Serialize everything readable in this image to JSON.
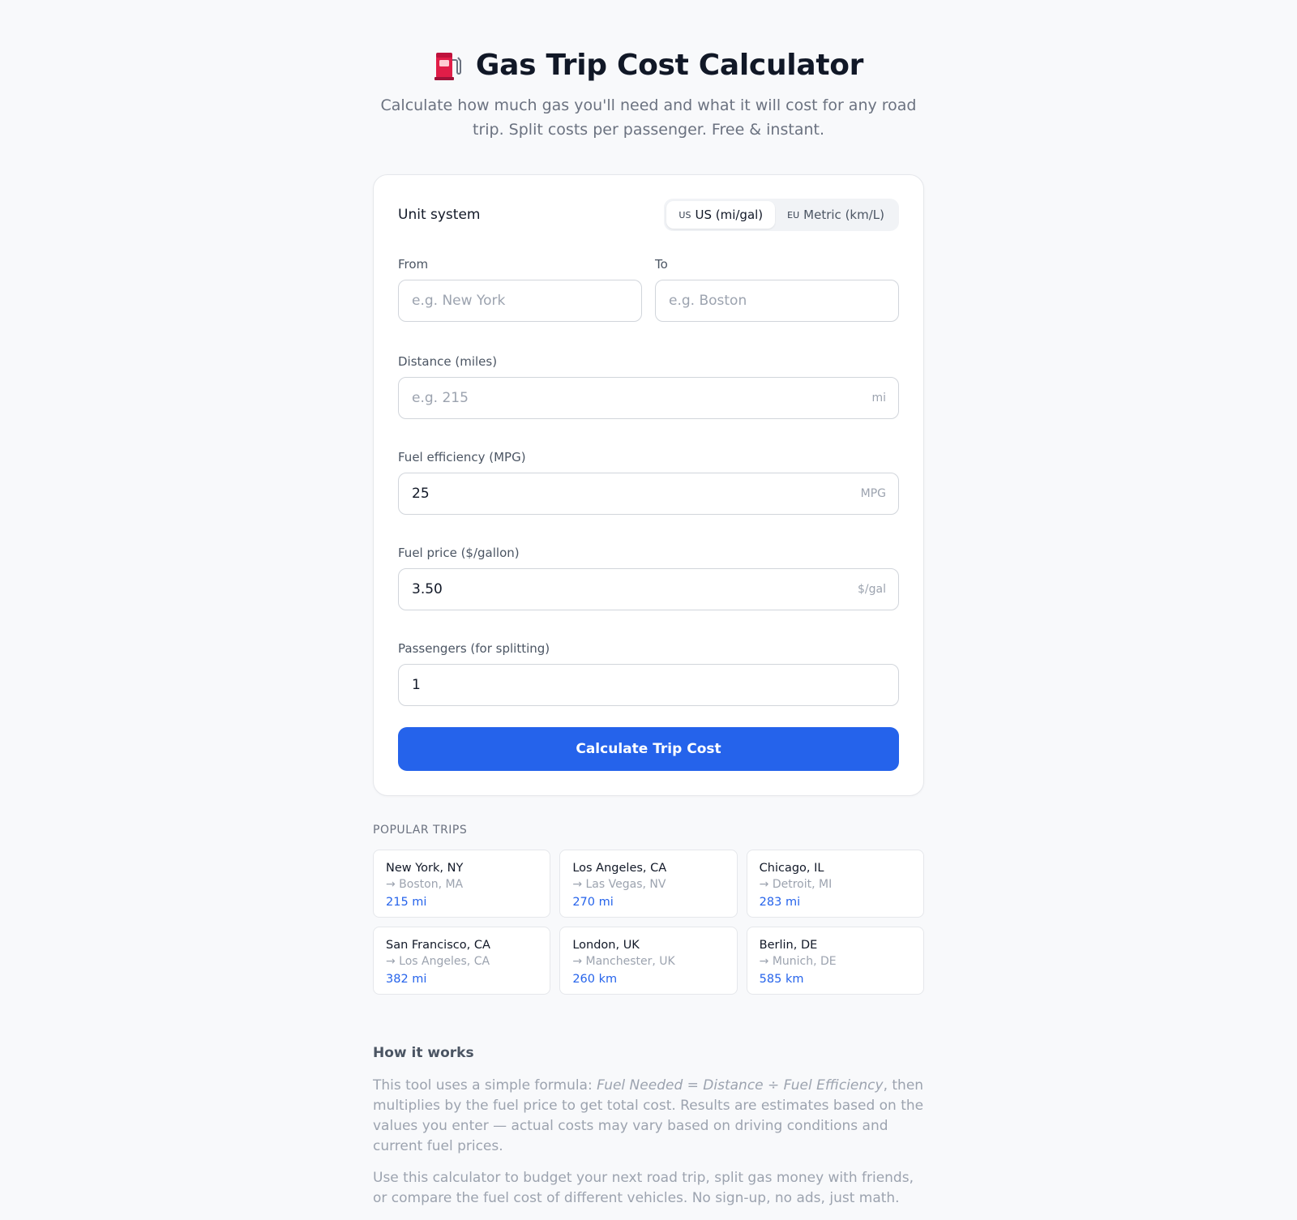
{
  "hero": {
    "icon": "fuel-pump-icon",
    "title": "Gas Trip Cost Calculator",
    "subtitle": "Calculate how much gas you'll need and what it will cost for any road trip. Split costs per passenger. Free & instant."
  },
  "form": {
    "unit_system_label": "Unit system",
    "units": [
      {
        "flag": "US",
        "label": "US (mi/gal)",
        "active": true
      },
      {
        "flag": "EU",
        "label": "Metric (km/L)",
        "active": false
      }
    ],
    "from": {
      "label": "From",
      "placeholder": "e.g. New York",
      "value": ""
    },
    "to": {
      "label": "To",
      "placeholder": "e.g. Boston",
      "value": ""
    },
    "distance": {
      "label": "Distance (miles)",
      "placeholder": "e.g. 215",
      "value": "",
      "suffix": "mi"
    },
    "efficiency": {
      "label": "Fuel efficiency (MPG)",
      "value": "25",
      "suffix": "MPG"
    },
    "price": {
      "label": "Fuel price ($/gallon)",
      "value": "3.50",
      "suffix": "$/gal"
    },
    "passengers": {
      "label": "Passengers (for splitting)",
      "value": "1"
    },
    "submit_label": "Calculate Trip Cost"
  },
  "popular": {
    "title": "POPULAR TRIPS",
    "trips": [
      {
        "from": "New York, NY",
        "to": "→ Boston, MA",
        "distance": "215 mi"
      },
      {
        "from": "Los Angeles, CA",
        "to": "→ Las Vegas, NV",
        "distance": "270 mi"
      },
      {
        "from": "Chicago, IL",
        "to": "→ Detroit, MI",
        "distance": "283 mi"
      },
      {
        "from": "San Francisco, CA",
        "to": "→ Los Angeles, CA",
        "distance": "382 mi"
      },
      {
        "from": "London, UK",
        "to": "→ Manchester, UK",
        "distance": "260 km"
      },
      {
        "from": "Berlin, DE",
        "to": "→ Munich, DE",
        "distance": "585 km"
      }
    ]
  },
  "how": {
    "title": "How it works",
    "p1_before": "This tool uses a simple formula: ",
    "p1_formula": "Fuel Needed = Distance ÷ Fuel Efficiency",
    "p1_after": ", then multiplies by the fuel price to get total cost. Results are estimates based on the values you enter — actual costs may vary based on driving conditions and current fuel prices.",
    "p2": "Use this calculator to budget your next road trip, split gas money with friends, or compare the fuel cost of different vehicles. No sign-up, no ads, just math."
  },
  "colors": {
    "accent": "#2563eb",
    "pump": "#e11d48",
    "background": "#f8f9fb"
  }
}
